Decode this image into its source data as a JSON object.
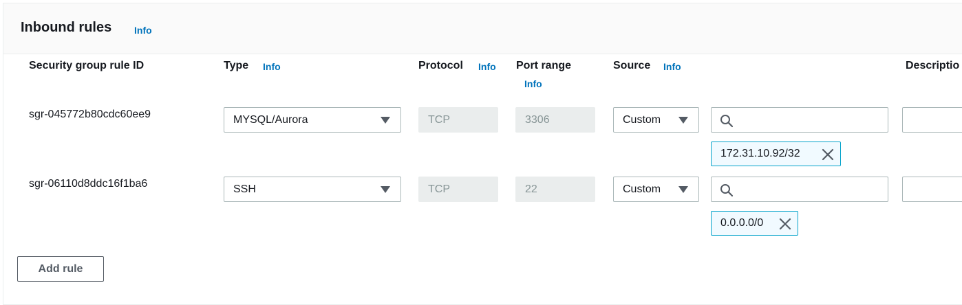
{
  "panel": {
    "title": "Inbound rules",
    "info": "Info"
  },
  "columns": {
    "rule_id": "Security group rule ID",
    "type": "Type",
    "type_info": "Info",
    "protocol": "Protocol",
    "protocol_info": "Info",
    "port_range": "Port range",
    "port_range_info": "Info",
    "source": "Source",
    "source_info": "Info",
    "description": "Descriptio"
  },
  "rules": [
    {
      "id": "sgr-045772b80cdc60ee9",
      "type": "MYSQL/Aurora",
      "protocol": "TCP",
      "port_range": "3306",
      "source": "Custom",
      "search_value": "",
      "cidr": "172.31.10.92/32",
      "description": ""
    },
    {
      "id": "sgr-06110d8ddc16f1ba6",
      "type": "SSH",
      "protocol": "TCP",
      "port_range": "22",
      "source": "Custom",
      "search_value": "",
      "cidr": "0.0.0.0/0",
      "description": ""
    }
  ],
  "actions": {
    "add_rule": "Add rule"
  },
  "colors": {
    "accent": "#0073bb",
    "token_border": "#00a1c9",
    "token_bg": "#f1faff"
  }
}
